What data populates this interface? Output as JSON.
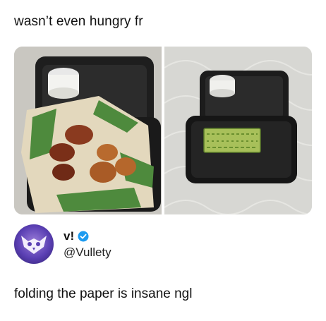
{
  "post": {
    "caption": "wasn’t even hungry fr",
    "reply_text": "folding the paper is insane ngl"
  },
  "author": {
    "display_name": "v!",
    "handle": "@Vullety",
    "verified": true
  },
  "images": [
    {
      "name": "chicken-wings-container-photo"
    },
    {
      "name": "folded-paper-container-photo"
    }
  ],
  "colors": {
    "verified_badge": "#1d9bf0",
    "avatar_purple": "#5a3fb3",
    "wrapper_green": "#3f8a3a"
  }
}
